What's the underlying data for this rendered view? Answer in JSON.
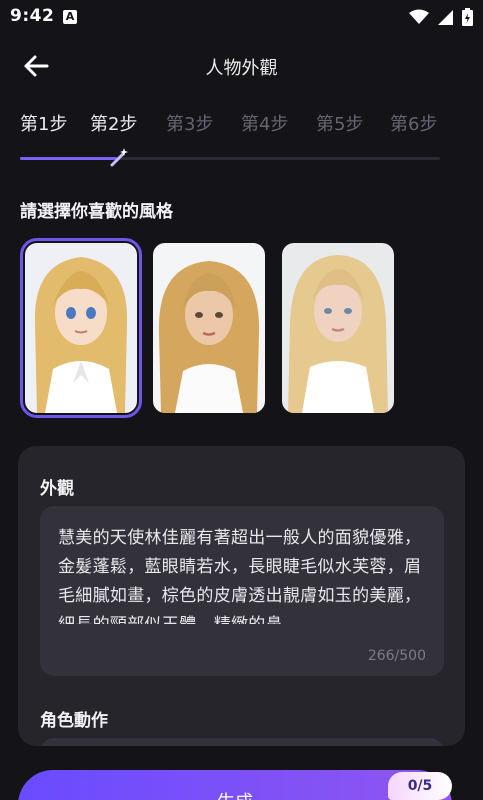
{
  "status_bar": {
    "time": "9:42",
    "notification_glyph": "A"
  },
  "header": {
    "title": "人物外觀"
  },
  "steps": [
    {
      "label": "第1步",
      "active": true
    },
    {
      "label": "第2步",
      "active": true
    },
    {
      "label": "第3步",
      "active": false
    },
    {
      "label": "第4步",
      "active": false
    },
    {
      "label": "第5步",
      "active": false
    },
    {
      "label": "第6步",
      "active": false
    }
  ],
  "progress": {
    "fraction": 0.23
  },
  "style_section": {
    "title": "請選擇你喜歡的風格",
    "options": [
      {
        "id": "anime",
        "selected": true
      },
      {
        "id": "semi-realistic",
        "selected": false
      },
      {
        "id": "realistic",
        "selected": false
      }
    ]
  },
  "appearance": {
    "label": "外觀",
    "text": "慧美的天使林佳麗有著超出一般人的面貌優雅，金髮蓬鬆，藍眼睛若水，長眼睫毛似水芙蓉，眉毛細膩如畫，棕色的皮膚透出靚膚如玉的美麗，細長的頸部似玉體，精緻的鼻",
    "count": "266/500"
  },
  "action": {
    "label": "角色動作"
  },
  "generate": {
    "label": "生成",
    "quota": "0/5"
  },
  "colors": {
    "accent": "#7b61ff",
    "background": "#141318",
    "panel": "#26252c"
  },
  "icons": [
    "back-arrow-icon",
    "wifi-icon",
    "signal-icon",
    "battery-icon",
    "magic-wand-icon"
  ]
}
